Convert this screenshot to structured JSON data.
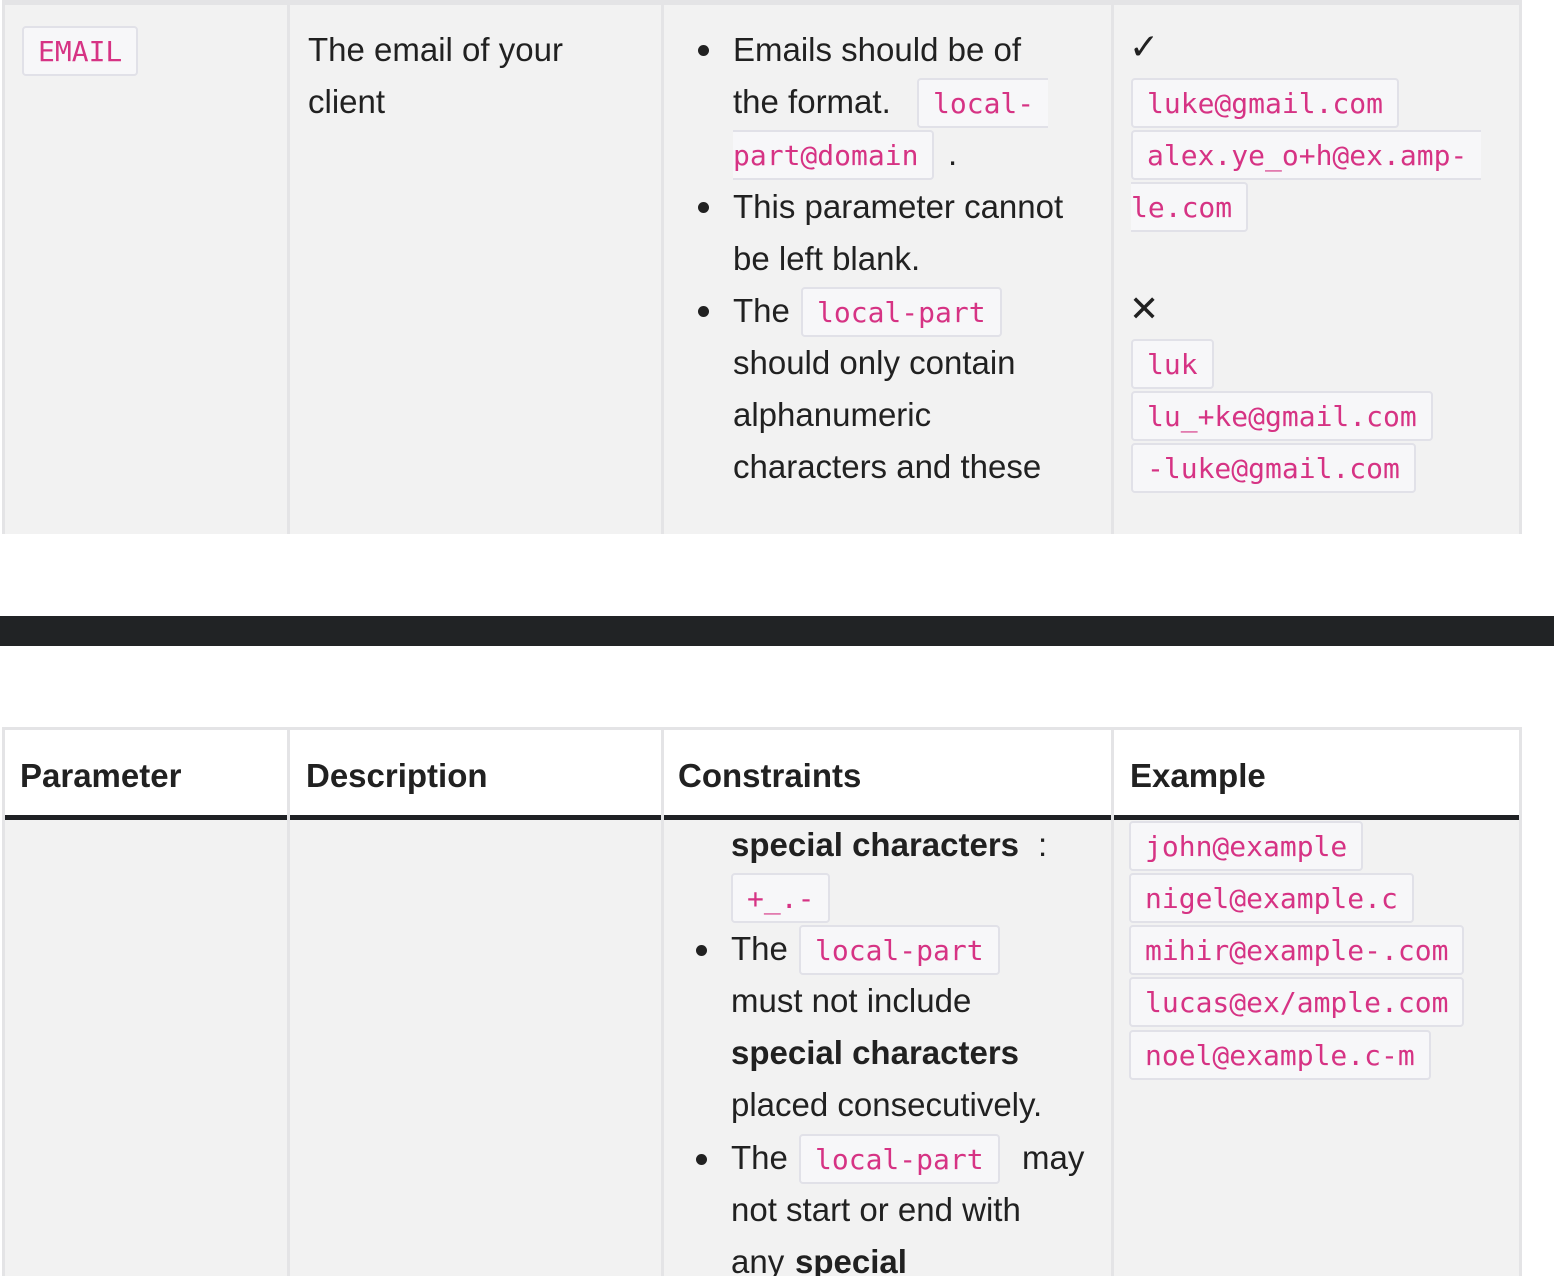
{
  "table": {
    "headers": [
      "Parameter",
      "Description",
      "Constraints",
      "Example"
    ]
  },
  "row_top": {
    "parameter": "EMAIL",
    "description": [
      "The email of your",
      "client"
    ],
    "constraints": {
      "c1_line1": "Emails should be of",
      "c1_line2": "the format.",
      "c1_code_a": "local-",
      "c1_code_b": "part@domain",
      "c1_period": ".",
      "c2_line1": "This parameter cannot",
      "c2_line2": "be left blank.",
      "c3_the": "The",
      "c3_code": "local-part",
      "c3_line2": "should only contain",
      "c3_line3": "alphanumeric",
      "c3_line4": "characters and these"
    },
    "example": {
      "valid_icon": "check-icon",
      "valid_symbol": "✓",
      "valid": [
        "luke@gmail.com"
      ],
      "valid_split_a": "alex.ye_o+h@ex.amp-",
      "valid_split_b": "le.com",
      "invalid_icon": "cross-icon",
      "invalid_symbol": "✕",
      "invalid": [
        "luk",
        "lu_+ke@gmail.com",
        "-luke@gmail.com"
      ]
    }
  },
  "row_bottom": {
    "constraints": {
      "special_chars": "special characters",
      "colon": ":",
      "chars_code": "+_.-",
      "c4_the": "The",
      "c4_code": "local-part",
      "c4_line2": "must not include",
      "c4_line3_bold": "special characters",
      "c4_line4": "placed consecutively.",
      "c5_the": "The",
      "c5_code": "local-part",
      "c5_may": "may",
      "c5_line2": "not start or end with",
      "c5_line3": "any",
      "c5_line3_bold": "special"
    },
    "example": {
      "invalid": [
        "john@example",
        "nigel@example.c",
        "mihir@example-.com",
        "lucas@ex/ample.com",
        "noel@example.c-m"
      ]
    }
  },
  "colors": {
    "code_text": "#d63384",
    "code_bg": "#f7f7f9",
    "row_bg": "#f2f2f2",
    "divider": "#212325"
  }
}
